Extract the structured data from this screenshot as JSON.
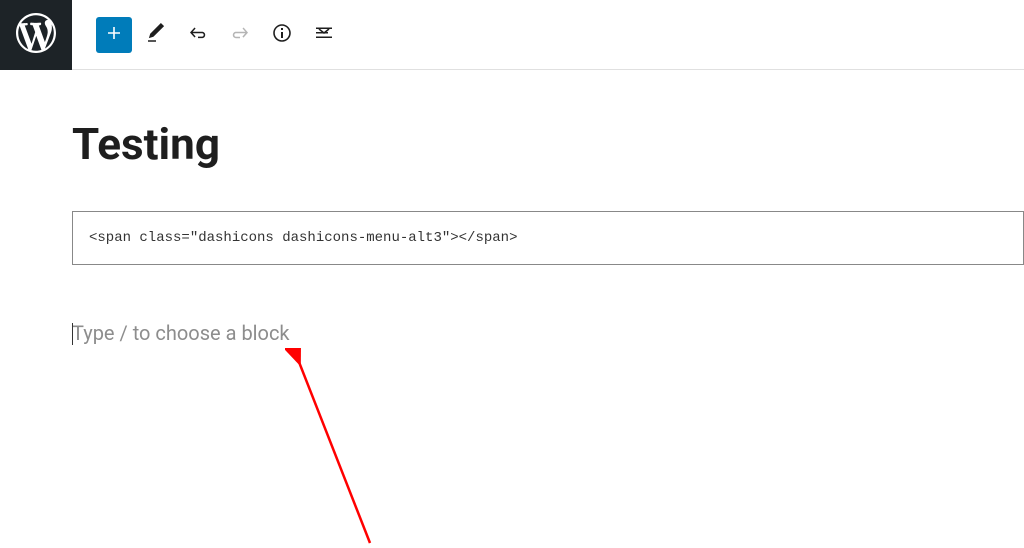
{
  "title": "Testing",
  "code_block": {
    "content": "<span class=\"dashicons dashicons-menu-alt3\"></span>"
  },
  "placeholder": "Type / to choose a block",
  "toolbar": {
    "add_label": "Add block",
    "edit_label": "Tools",
    "undo_label": "Undo",
    "redo_label": "Redo",
    "info_label": "Details",
    "outline_label": "Outline"
  },
  "colors": {
    "primary": "#007cba",
    "dark": "#1d2327"
  }
}
